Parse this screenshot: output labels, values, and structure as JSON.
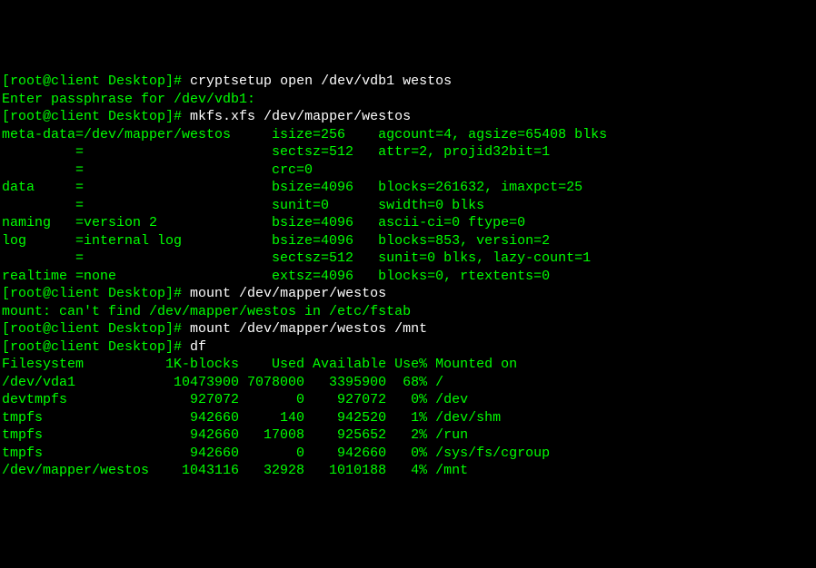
{
  "lines": [
    {
      "prompt": "[root@client Desktop]# ",
      "cmd": "cryptsetup open /dev/vdb1 westos"
    },
    {
      "text": "Enter passphrase for /dev/vdb1:"
    },
    {
      "prompt": "[root@client Desktop]# ",
      "cmd": "mkfs.xfs /dev/mapper/westos"
    },
    {
      "text": "meta-data=/dev/mapper/westos     isize=256    agcount=4, agsize=65408 blks"
    },
    {
      "text": "         =                       sectsz=512   attr=2, projid32bit=1"
    },
    {
      "text": "         =                       crc=0"
    },
    {
      "text": "data     =                       bsize=4096   blocks=261632, imaxpct=25"
    },
    {
      "text": "         =                       sunit=0      swidth=0 blks"
    },
    {
      "text": "naming   =version 2              bsize=4096   ascii-ci=0 ftype=0"
    },
    {
      "text": "log      =internal log           bsize=4096   blocks=853, version=2"
    },
    {
      "text": "         =                       sectsz=512   sunit=0 blks, lazy-count=1"
    },
    {
      "text": "realtime =none                   extsz=4096   blocks=0, rtextents=0"
    },
    {
      "prompt": "[root@client Desktop]# ",
      "cmd": "mount /dev/mapper/westos"
    },
    {
      "text": "mount: can't find /dev/mapper/westos in /etc/fstab"
    },
    {
      "prompt": "[root@client Desktop]# ",
      "cmd": "mount /dev/mapper/westos /mnt"
    },
    {
      "prompt": "[root@client Desktop]# ",
      "cmd": "df"
    },
    {
      "text": "Filesystem          1K-blocks    Used Available Use% Mounted on"
    },
    {
      "text": "/dev/vda1            10473900 7078000   3395900  68% /"
    },
    {
      "text": "devtmpfs               927072       0    927072   0% /dev"
    },
    {
      "text": "tmpfs                  942660     140    942520   1% /dev/shm"
    },
    {
      "text": "tmpfs                  942660   17008    925652   2% /run"
    },
    {
      "text": "tmpfs                  942660       0    942660   0% /sys/fs/cgroup"
    },
    {
      "text": "/dev/mapper/westos    1043116   32928   1010188   4% /mnt"
    }
  ]
}
